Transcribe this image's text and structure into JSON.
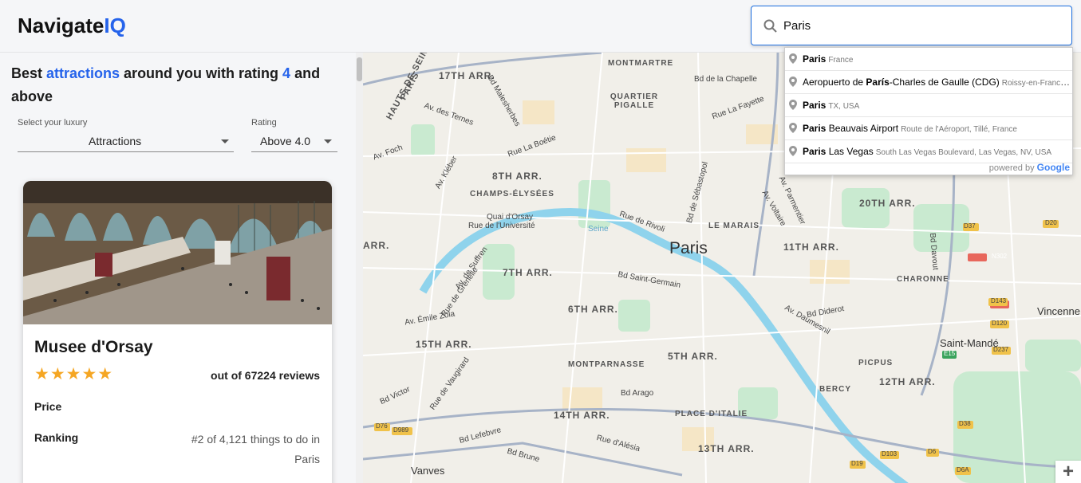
{
  "app": {
    "logo_main": "Navigate",
    "logo_accent": "IQ"
  },
  "search": {
    "value": "Paris",
    "suggestions": [
      {
        "bold": "Paris",
        "rest": "",
        "secondary": "France"
      },
      {
        "prefix": "Aeropuerto de ",
        "bold": "París",
        "rest": "-Charles de Gaulle (CDG)",
        "secondary": "Roissy-en-France,..."
      },
      {
        "bold": "Paris",
        "rest": "",
        "secondary": "TX, USA"
      },
      {
        "bold": "Paris",
        "rest": " Beauvais Airport",
        "secondary": "Route de l'Aéroport, Tillé, France"
      },
      {
        "bold": "Paris",
        "rest": " Las Vegas",
        "secondary": "South Las Vegas Boulevard, Las Vegas, NV, USA"
      }
    ],
    "powered_by": "powered by",
    "google": "Google"
  },
  "sidebar": {
    "heading_part1": "Best ",
    "heading_link": "attractions",
    "heading_part2": " around you with rating ",
    "heading_rating": "4",
    "heading_part3": " and above",
    "luxury_label": "Select your luxury",
    "luxury_value": "Attractions",
    "rating_label": "Rating",
    "rating_value": "Above 4.0"
  },
  "card": {
    "title": "Musee d'Orsay",
    "stars": "★★★★★",
    "rating_stars": 5,
    "reviews": "out of 67224 reviews",
    "price_label": "Price",
    "ranking_label": "Ranking",
    "ranking_value": "#2 of 4,121 things to do in Paris"
  },
  "map": {
    "city": "Paris",
    "districts": [
      "17TH ARR.",
      "8TH ARR.",
      "CHAMPS-ÉLYSÉES",
      "7TH ARR.",
      "6TH ARR.",
      "15TH ARR.",
      "5TH ARR.",
      "MONTPARNASSE",
      "14TH ARR.",
      "PLACE D'ITALIE",
      "13TH ARR.",
      "LE MARAIS",
      "11TH ARR.",
      "20TH ARR.",
      "CHARONNE",
      "12TH ARR.",
      "PICPUS",
      "BERCY",
      "MONTMARTRE",
      "QUARTIER PIGALLE",
      "HAUTS-DE-SEINE",
      "PARIS",
      "Vanves",
      "Vincenne",
      "Saint-Mandé",
      "ARR."
    ],
    "streets": [
      "Bd de la Chapelle",
      "Rue La Fayette",
      "Bd Malesherbes",
      "Av. des Ternes",
      "Rue La Boétie",
      "Av. Foch",
      "Av. Kléber",
      "Quai d'Orsay",
      "Rue de l'Université",
      "Rue de Rivoli",
      "Bd de Sébastopol",
      "Bd Saint-Germain",
      "Av. de Suffren",
      "Rue de Grenelle",
      "Av. Émile Zola",
      "Bd Diderot",
      "Av. Daumesnil",
      "Bd Arago",
      "Rue de Vaugirard",
      "Bd Victor",
      "Bd Lefebvre",
      "Rue d'Alésia",
      "Bd Brune",
      "Bd Davout",
      "Av. Parmentier",
      "Av. Voltaire",
      "Seine"
    ],
    "roads": [
      "D37",
      "D20",
      "N302",
      "D143",
      "D120",
      "E15",
      "D237",
      "D76",
      "D989",
      "D38",
      "D103",
      "D19",
      "D6",
      "D6A"
    ],
    "zoom_in": "+"
  }
}
